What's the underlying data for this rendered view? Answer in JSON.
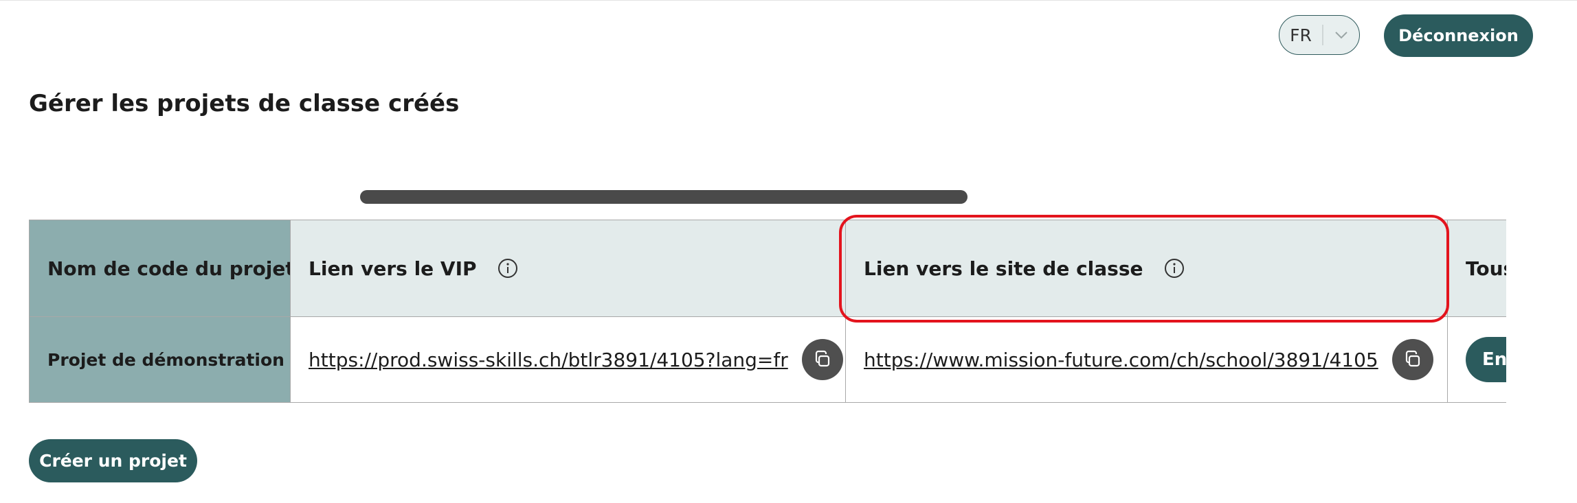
{
  "header": {
    "language": {
      "selected": "FR"
    },
    "logout_label": "Déconnexion"
  },
  "page": {
    "title": "Gérer les projets de classe créés"
  },
  "table": {
    "columns": [
      {
        "label": "Nom de code du projet",
        "info_icon": false
      },
      {
        "label": "Lien vers le VIP",
        "info_icon": true
      },
      {
        "label": "Lien vers le site de classe",
        "info_icon": true
      },
      {
        "label": "Tous",
        "info_icon": false
      }
    ],
    "rows": [
      {
        "name": "Projet de démonstration",
        "vip_link": "https://prod.swiss-skills.ch/btlr3891/4105?lang=fr",
        "class_site_link": "https://www.mission-future.com/ch/school/3891/4105",
        "action_label": "En"
      }
    ]
  },
  "actions": {
    "create_label": "Créer un projet"
  },
  "colors": {
    "primary": "#2b5b5d",
    "header_bg": "#e3ebeb",
    "name_col_bg": "#8cadae",
    "highlight": "#e3141d",
    "copy_btn": "#4f4f4f"
  },
  "icons": [
    "chevron-down-icon",
    "info-icon",
    "copy-icon"
  ]
}
